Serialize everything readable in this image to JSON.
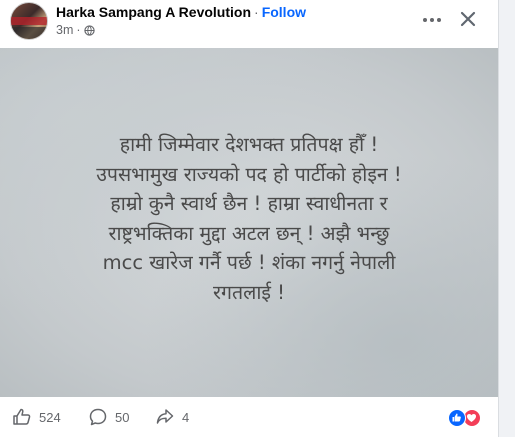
{
  "post": {
    "author": "Harka Sampang A Revolution",
    "separator": "·",
    "follow_label": "Follow",
    "time": "3m",
    "time_separator": "·"
  },
  "image_text": [
    "हामी जिम्मेवार देशभक्त प्रतिपक्ष हौँ !",
    "उपसभामुख राज्यको पद हो पार्टीको होइन !",
    "हाम्रो कुनै स्वार्थ छैन ! हाम्रा स्वाधीनता र",
    "राष्ट्रभक्तिका मुद्दा अटल छन् ! अझै भन्छु",
    "mcc खारेज गर्नै पर्छ ! शंका नगर्नु नेपाली",
    "रगतलाई !"
  ],
  "footer": {
    "like_count": "524",
    "comment_count": "50",
    "share_count": "4"
  },
  "icons": {
    "more": "more-options-icon",
    "close": "close-icon",
    "privacy": "globe-icon",
    "like": "thumbs-up-icon",
    "comment": "comment-bubble-icon",
    "share": "share-icon"
  },
  "colors": {
    "accent": "#0866ff",
    "love": "#f33e58",
    "secondary_text": "#65676b"
  }
}
